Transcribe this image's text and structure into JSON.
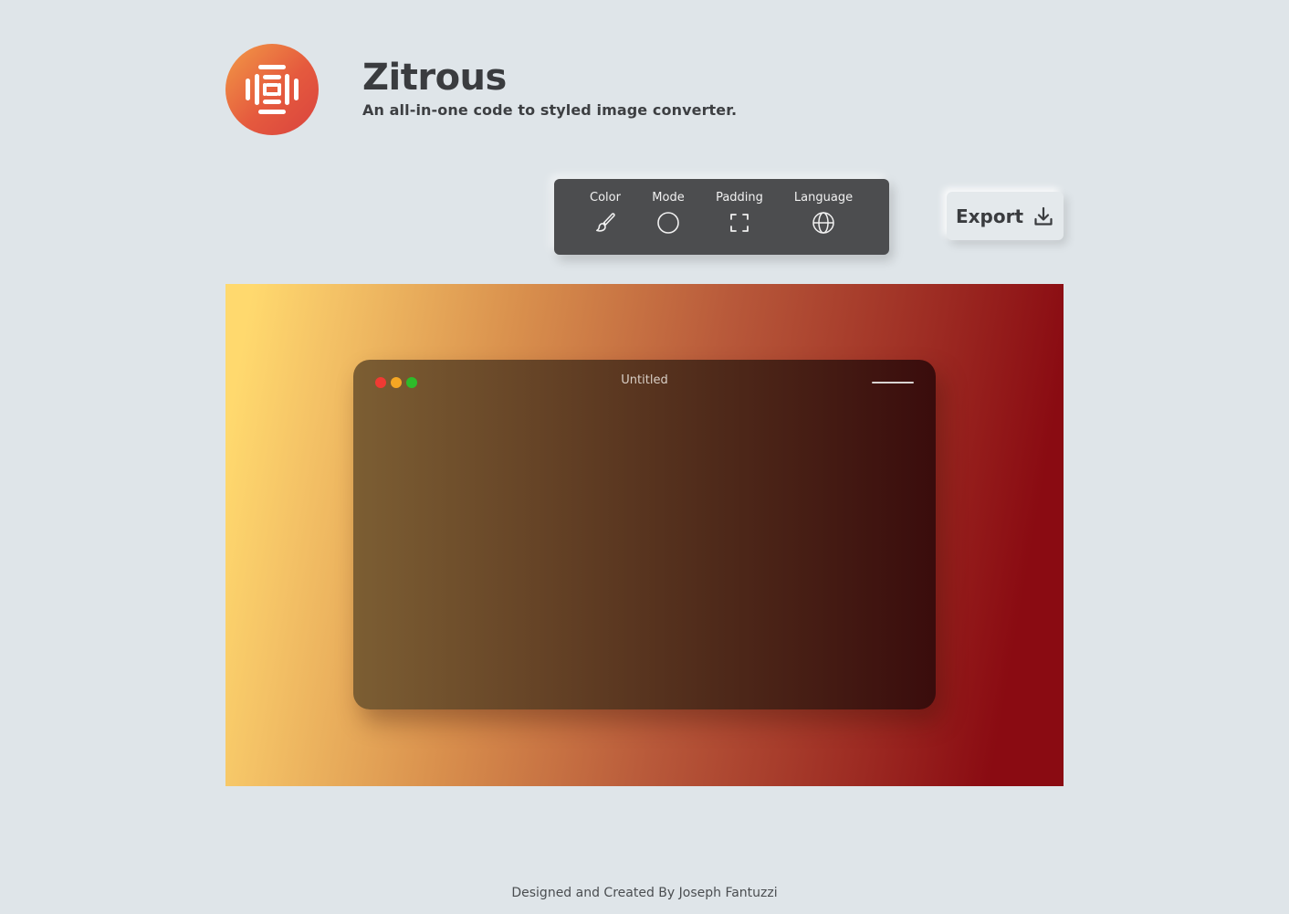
{
  "app": {
    "name": "Zitrous",
    "tagline": "An all-in-one code to styled image converter.",
    "logo_icon": "stacked-lines-icon",
    "logo_colors": [
      "#f29a46",
      "#d9433e"
    ]
  },
  "toolbar": {
    "items": [
      {
        "label": "Color",
        "icon": "brush-icon"
      },
      {
        "label": "Mode",
        "icon": "circle-icon"
      },
      {
        "label": "Padding",
        "icon": "corners-icon"
      },
      {
        "label": "Language",
        "icon": "globe-icon"
      }
    ],
    "background": "#4c4d4f"
  },
  "export": {
    "label": "Export",
    "icon": "download-icon"
  },
  "preview": {
    "gradient_colors": [
      "#ffd96e",
      "#d9904d",
      "#b8593a",
      "#8a0b12"
    ],
    "window": {
      "title": "Untitled",
      "controls": {
        "close_color": "#f03a33",
        "minimize_color": "#f5a623",
        "maximize_color": "#2dbb2a"
      },
      "menu_icon": "menu-line-icon"
    }
  },
  "footer": {
    "text": "Designed and Created By Joseph Fantuzzi"
  }
}
